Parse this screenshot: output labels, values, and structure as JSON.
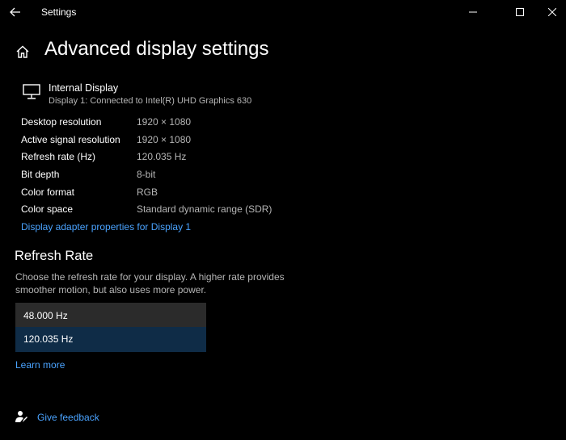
{
  "window": {
    "title": "Settings",
    "back_icon": "back-arrow-icon",
    "minimize_icon": "minimize-icon",
    "maximize_icon": "maximize-icon",
    "close_icon": "close-icon"
  },
  "page": {
    "home_icon": "home-icon",
    "title": "Advanced display settings"
  },
  "display": {
    "icon": "monitor-icon",
    "name": "Internal Display",
    "subtitle": "Display 1: Connected to Intel(R) UHD Graphics 630"
  },
  "info": [
    {
      "label": "Desktop resolution",
      "value": "1920 × 1080"
    },
    {
      "label": "Active signal resolution",
      "value": "1920 × 1080"
    },
    {
      "label": "Refresh rate (Hz)",
      "value": "120.035 Hz"
    },
    {
      "label": "Bit depth",
      "value": "8-bit"
    },
    {
      "label": "Color format",
      "value": "RGB"
    },
    {
      "label": "Color space",
      "value": "Standard dynamic range (SDR)"
    }
  ],
  "adapter_link": "Display adapter properties for Display 1",
  "refresh_rate": {
    "title": "Refresh Rate",
    "description": "Choose the refresh rate for your display. A higher rate provides smoother motion, but also uses more power.",
    "options": [
      "48.000 Hz",
      "120.035 Hz"
    ],
    "selected": "120.035 Hz"
  },
  "learn_more": "Learn more",
  "feedback": {
    "icon": "feedback-icon",
    "label": "Give feedback"
  },
  "colors": {
    "background": "#000000",
    "link": "#4aa3ff",
    "selected_option": "#0f2c47",
    "list_background": "#2b2b2b",
    "secondary_text": "#b5b5b5"
  }
}
